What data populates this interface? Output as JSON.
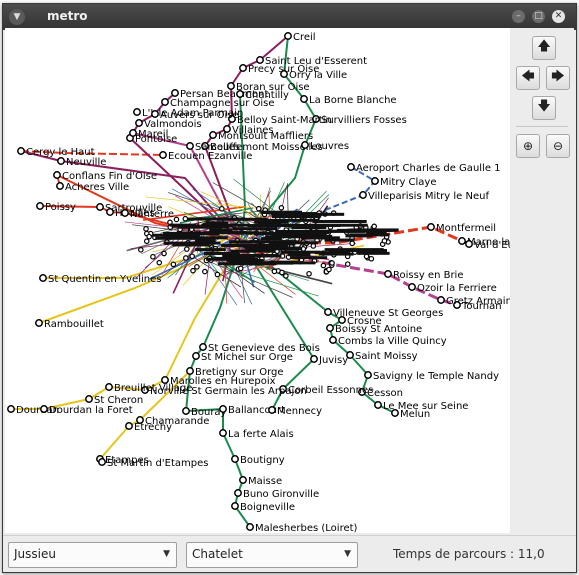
{
  "window": {
    "title": "metro"
  },
  "nav": {
    "up_icon": "arrow-up-icon",
    "left_icon": "arrow-left-icon",
    "right_icon": "arrow-right-icon",
    "down_icon": "arrow-down-icon",
    "zoom_in_icon": "zoom-in-icon",
    "zoom_out_icon": "zoom-out-icon"
  },
  "route": {
    "from": "Jussieu",
    "to": "Chatelet",
    "travel_label": "Temps de parcours : 11,0"
  },
  "colors": {
    "rer_d": "#1a8b4c",
    "rer_c": "#e6c51b",
    "rer_a": "#e0391f",
    "rer_b": "#3c67b8",
    "line_purple": "#8b1e5f",
    "line_magenta": "#b4408e"
  },
  "map": {
    "stations": [
      "Creil",
      "Saint Leu d'Esserent",
      "Precy sur Oise",
      "Orry la Ville",
      "Boran sur Oise",
      "La Borne Blanche",
      "Survilliers Fosses",
      "Belloy Saint-Martin",
      "Villaines",
      "Montsoult Maffliers",
      "Bouffemont Moisselles",
      "Louvres",
      "Valmondois",
      "L'Isle Adam Parmain",
      "Neuville",
      "Conflans Fin d'Oise",
      "Acheres Ville",
      "Poissy",
      "Aeroport Charles de Gaulle 1",
      "Mitry Claye",
      "Villeparisis Mitry le Neuf",
      "Montfermeil",
      "Marne la Vallee",
      "Val d'Europe",
      "Tournan",
      "Gretz Armainvilliers",
      "Ozoir la Ferriere",
      "Roissy en Brie",
      "St Quentin en Yvelines",
      "Boissy St Antoine",
      "Combs la Ville Quincy",
      "Saint Moissy",
      "Savigny le Temple Nandy",
      "Cesson",
      "Le Mee sur Seine",
      "Melun",
      "Corbeil Essonnes",
      "Villeneuve St Georges",
      "Crosne",
      "Juvisy",
      "Bretigny sur Orge",
      "St Michel sur Orge",
      "Norville St Germain les Arpajon",
      "Marolles en Hurepoix",
      "Breuillet Village",
      "St Cheron",
      "Dourdan",
      "Dourdan la Foret",
      "Etrechy",
      "Chamarande",
      "Etampes",
      "St Martin d'Etampes",
      "Bouray",
      "Ballancourt",
      "La ferte Alais",
      "Boutigny",
      "Maisse",
      "Buno Gironville",
      "Boigneville",
      "Malesherbes (Loiret)",
      "Mennecy",
      "Rambouillet",
      "Sartrouville",
      "Houilles",
      "Nanterre",
      "Cergy le Haut",
      "St Genevieve des Bois",
      "Persan Beaumont",
      "Champagne sur Oise",
      "Auvers sur Oise",
      "Pontoise",
      "Mareil",
      "Ecouen Ezanville",
      "Sarcelles",
      "Chantilly"
    ]
  }
}
